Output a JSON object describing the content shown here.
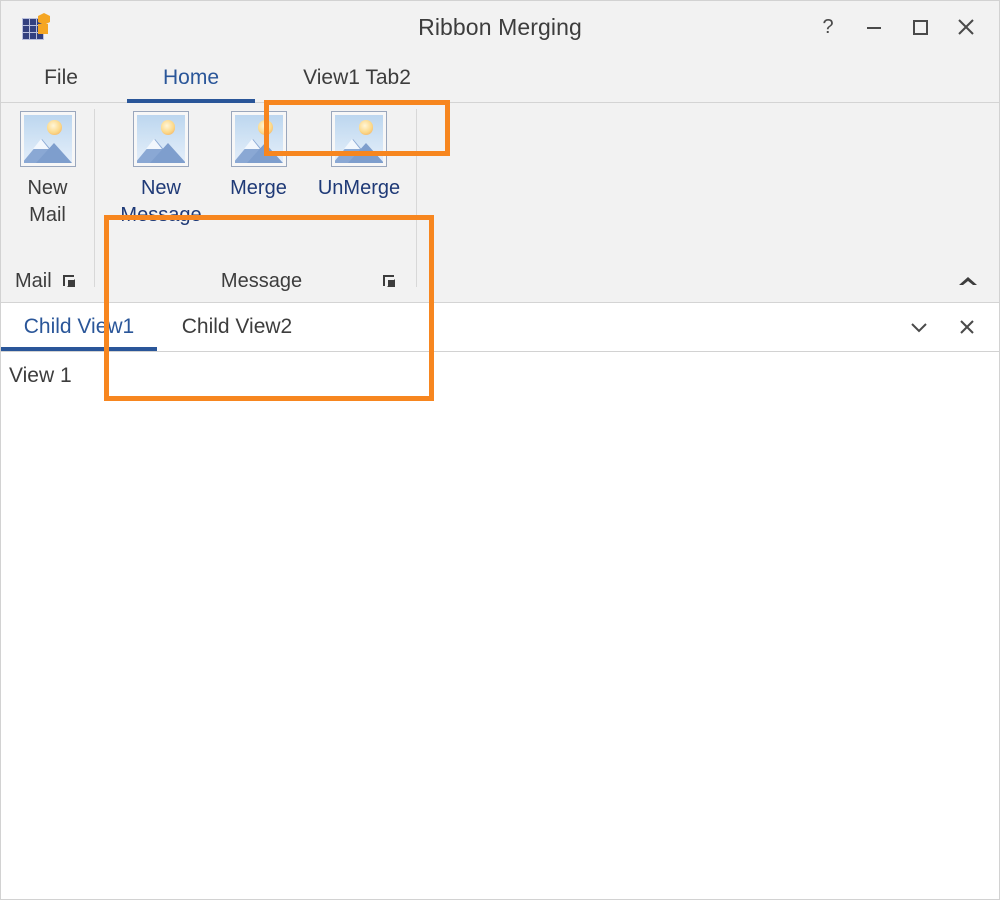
{
  "window": {
    "title": "Ribbon Merging",
    "logo_icon": "app-grid-logo-icon",
    "controls": [
      {
        "name": "help-button",
        "icon": "question-mark-icon",
        "label": "?"
      },
      {
        "name": "minimize-button",
        "icon": "minimize-icon",
        "label": "–"
      },
      {
        "name": "maximize-button",
        "icon": "maximize-icon",
        "label": "□"
      },
      {
        "name": "close-button",
        "icon": "close-icon",
        "label": "✕"
      }
    ]
  },
  "ribbon": {
    "tabs": [
      {
        "id": "file",
        "label": "File",
        "active": false
      },
      {
        "id": "home",
        "label": "Home",
        "active": true
      },
      {
        "id": "view1",
        "label": "View1 Tab2",
        "active": false,
        "highlighted": true
      }
    ],
    "groups": [
      {
        "id": "mail",
        "label": "Mail",
        "launcher_icon": "dialog-launcher-icon",
        "highlighted": false,
        "buttons": [
          {
            "id": "new-mail",
            "label_line1": "New",
            "label_line2": "Mail",
            "icon": "image-photo-icon",
            "style": "dark"
          }
        ]
      },
      {
        "id": "message",
        "label": "Message",
        "launcher_icon": "dialog-launcher-icon",
        "highlighted": true,
        "buttons": [
          {
            "id": "new-message",
            "label_line1": "New",
            "label_line2": "Message",
            "icon": "image-photo-icon",
            "style": "blue"
          },
          {
            "id": "merge",
            "label_line1": "Merge",
            "label_line2": "",
            "icon": "image-photo-icon",
            "style": "blue"
          },
          {
            "id": "unmerge",
            "label_line1": "UnMerge",
            "label_line2": "",
            "icon": "image-photo-icon",
            "style": "blue"
          }
        ]
      }
    ],
    "collapse_icon": "chevron-up-icon"
  },
  "child_views": {
    "tabs": [
      {
        "id": "child-view-1",
        "label": "Child View1",
        "active": true
      },
      {
        "id": "child-view-2",
        "label": "Child View2",
        "active": false
      }
    ],
    "actions": [
      {
        "name": "tab-list-dropdown-button",
        "icon": "chevron-down-icon"
      },
      {
        "name": "close-tab-button",
        "icon": "close-icon"
      }
    ]
  },
  "content": {
    "text": "View 1"
  },
  "colors": {
    "highlight": "#f7861f",
    "accent_blue": "#2a5699",
    "ribbon_bg": "#f2f2f2",
    "label_blue": "#1f3a77",
    "border": "#d2d2d2"
  }
}
